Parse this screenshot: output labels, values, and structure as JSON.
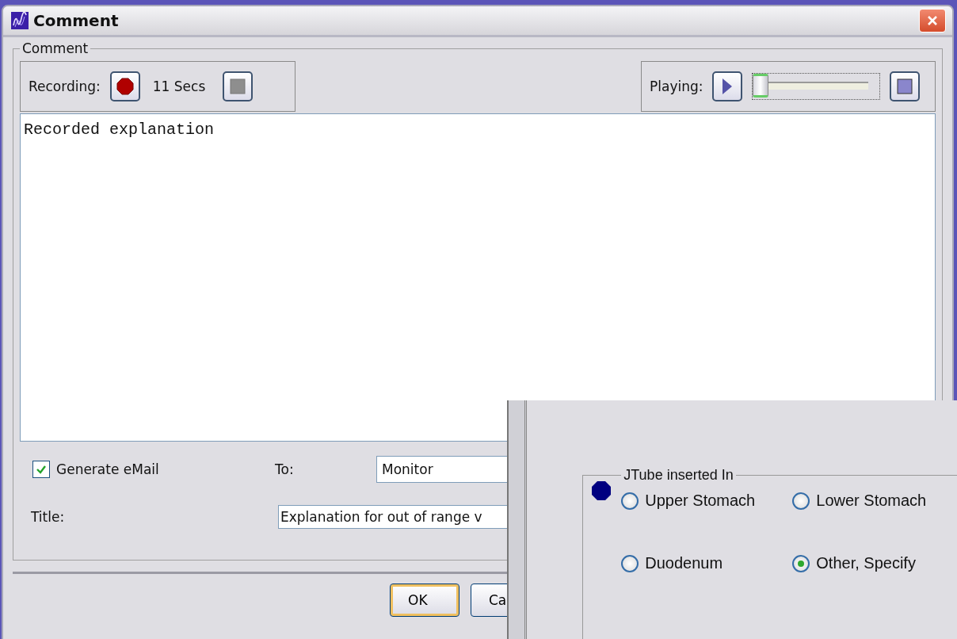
{
  "window": {
    "title": "Comment"
  },
  "comment_group": {
    "legend": "Comment",
    "recording": {
      "label": "Recording:",
      "duration": "11 Secs"
    },
    "playing": {
      "label": "Playing:",
      "level": 0
    },
    "text": "Recorded explanation",
    "generate_email": {
      "label": "Generate eMail",
      "checked": true
    },
    "to": {
      "label": "To:",
      "value": "Monitor"
    },
    "title_field": {
      "label": "Title:",
      "value": "Explanation for out of range v"
    }
  },
  "buttons": [
    {
      "label": "OK",
      "default": true
    },
    {
      "label": "Ca",
      "default": false
    }
  ],
  "overlay_panel": {
    "legend": "JTube inserted In",
    "options": [
      {
        "label": "Upper Stomach",
        "selected": false
      },
      {
        "label": "Lower Stomach",
        "selected": false
      },
      {
        "label": "Duodenum",
        "selected": false
      },
      {
        "label": "Other, Specify",
        "selected": true
      }
    ]
  }
}
